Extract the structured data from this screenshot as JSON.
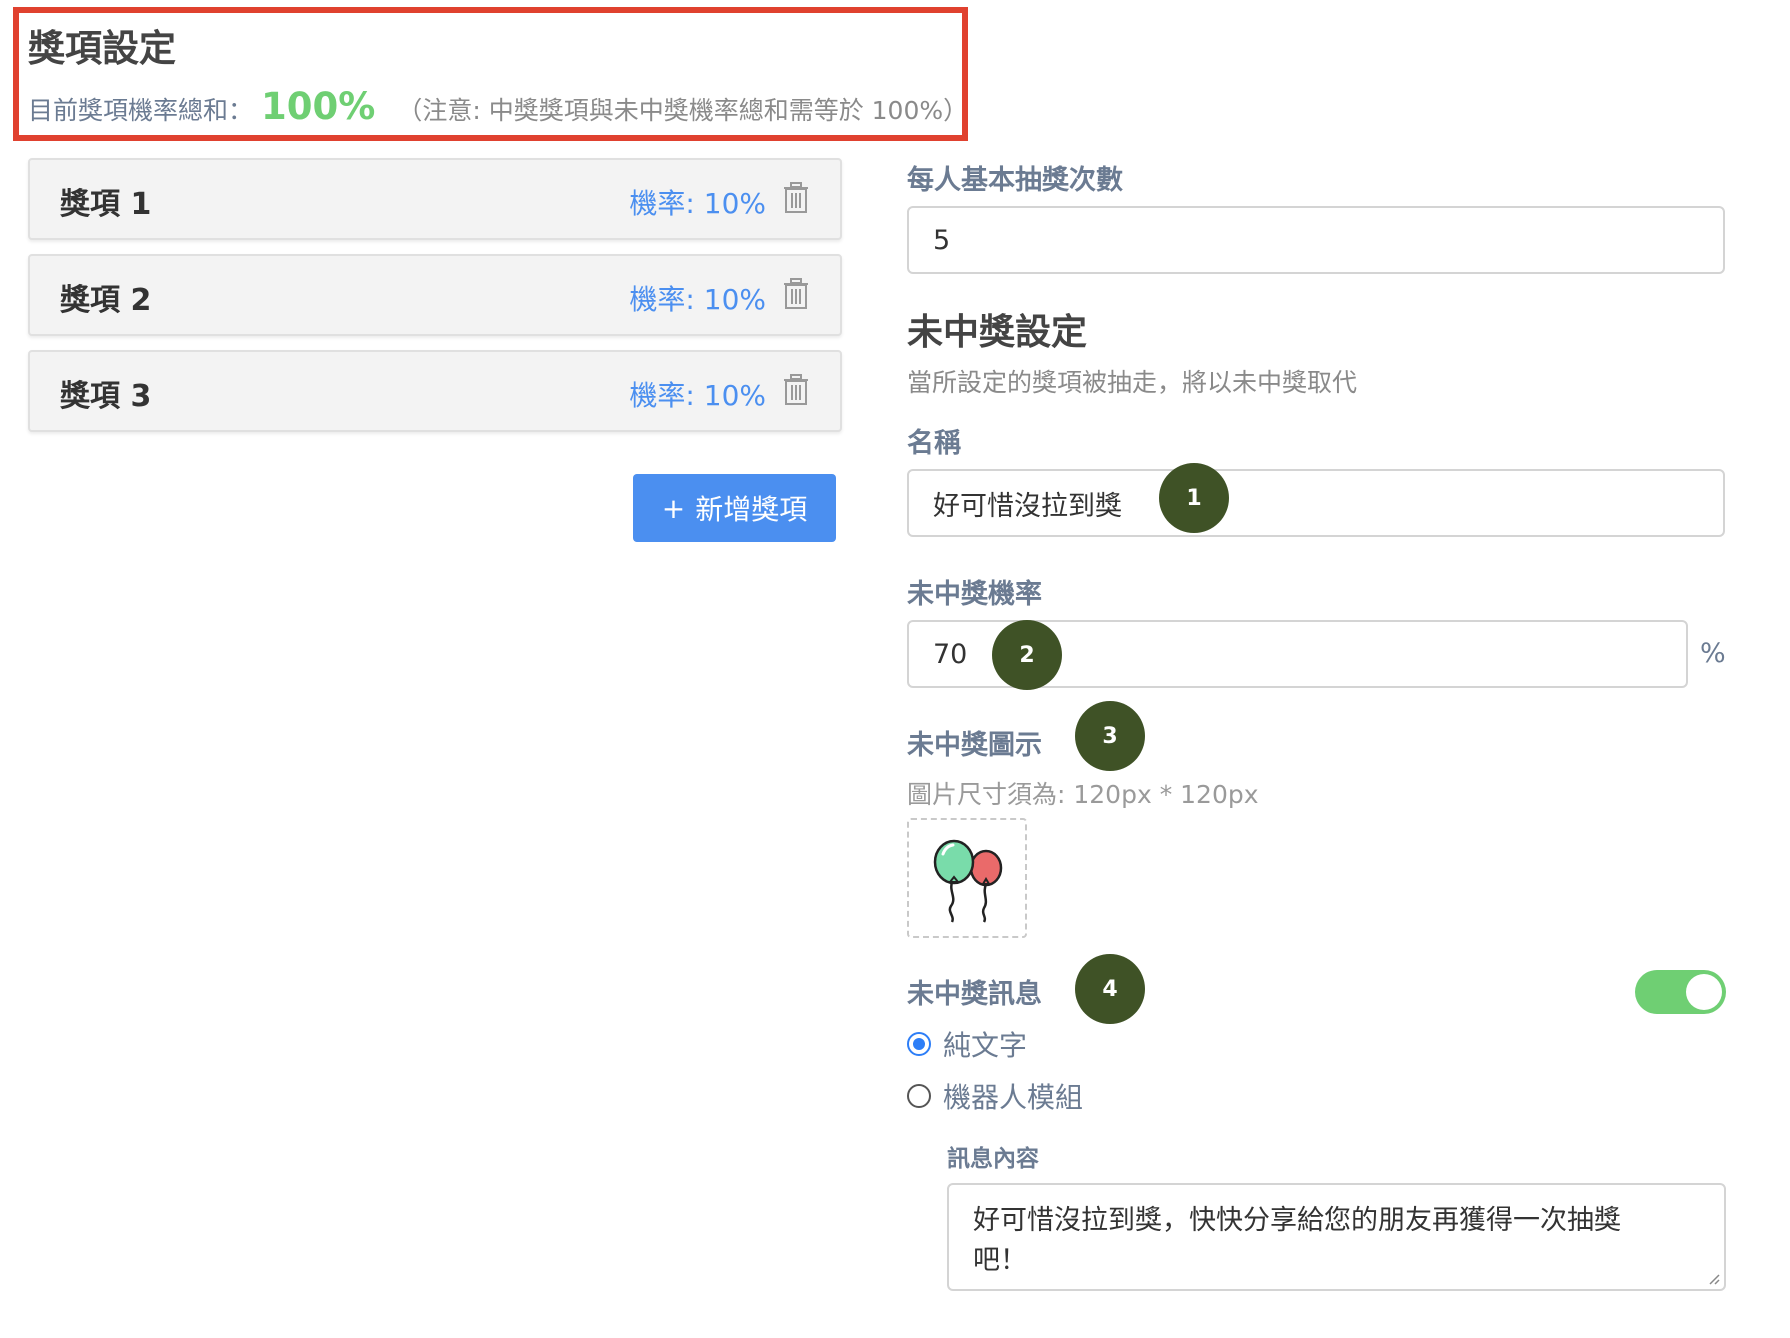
{
  "header": {
    "title": "獎項設定",
    "sum_label": "目前獎項機率總和：",
    "sum_value": "100%",
    "note": "（注意: 中獎獎項與未中獎機率總和需等於 100%）"
  },
  "prizes": [
    {
      "name": "獎項 1",
      "rate": "機率: 10%"
    },
    {
      "name": "獎項 2",
      "rate": "機率: 10%"
    },
    {
      "name": "獎項 3",
      "rate": "機率: 10%"
    }
  ],
  "add_button": {
    "icon": "+",
    "label": "新增獎項"
  },
  "draws": {
    "label": "每人基本抽獎次數",
    "value": "5"
  },
  "no_prize": {
    "title": "未中獎設定",
    "description": "當所設定的獎項被抽走，將以未中獎取代",
    "name_label": "名稱",
    "name_value": "好可惜沒拉到獎",
    "rate_label": "未中獎機率",
    "rate_value": "70",
    "rate_unit": "%",
    "icon_label": "未中獎圖示",
    "icon_hint": "圖片尺寸須為: 120px * 120px",
    "icon_name": "balloons-icon",
    "message_label": "未中獎訊息",
    "message_enabled": true,
    "options": [
      "純文字",
      "機器人模組"
    ],
    "selected_option": "純文字",
    "content_label": "訊息內容",
    "content_line1": "好可惜沒拉到獎，快快分享給您的朋友再獲得一次抽獎",
    "content_line2": "吧！"
  },
  "badges": [
    "1",
    "2",
    "3",
    "4"
  ],
  "colors": {
    "accent": "#4b8ff0",
    "success": "#6fcf73",
    "badge": "#3f5226",
    "highlight": "#e0412f"
  }
}
